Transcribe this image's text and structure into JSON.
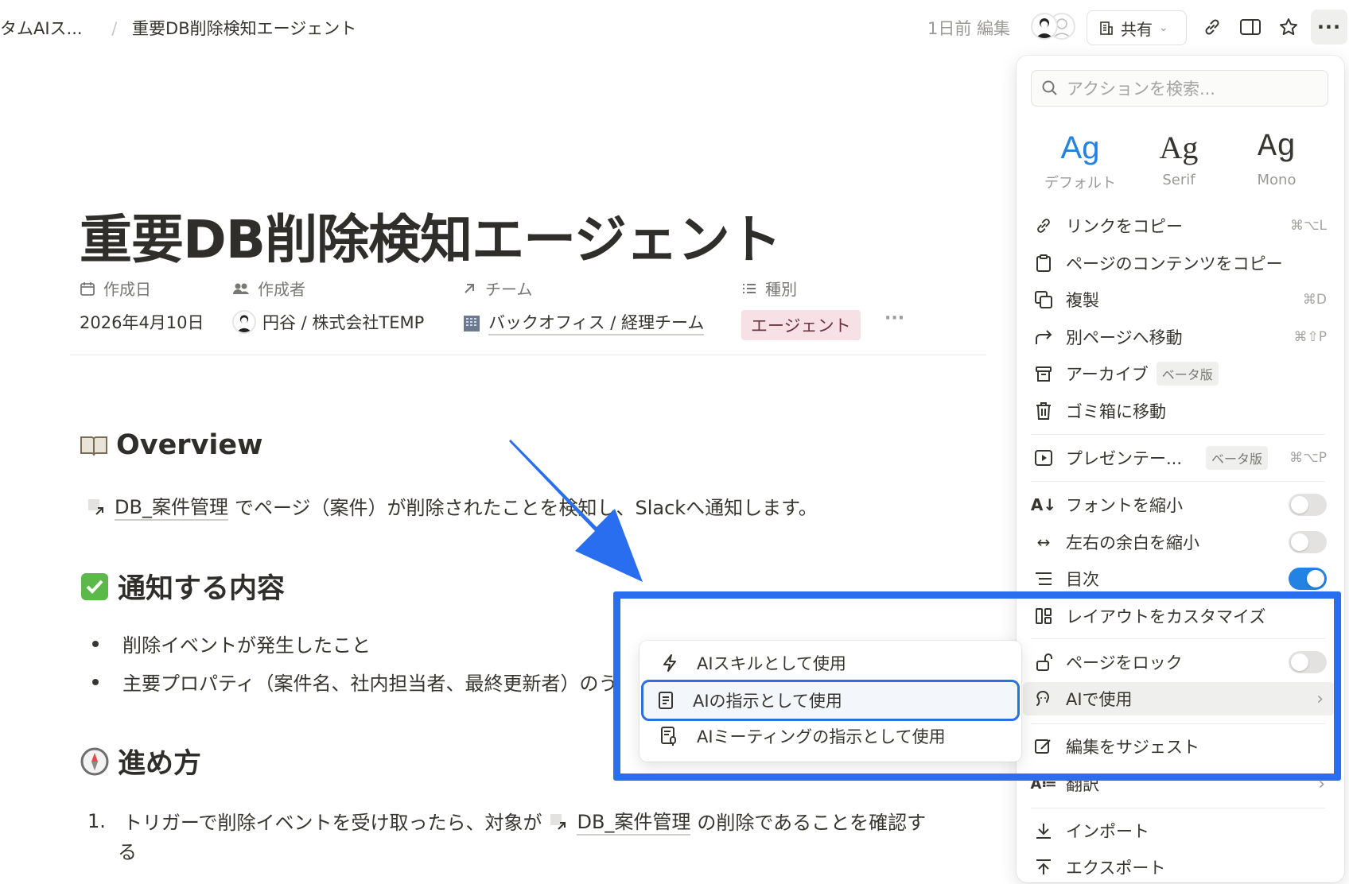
{
  "topbar": {
    "breadcrumb_parent": "タムAIス...",
    "breadcrumb_sep": "/",
    "breadcrumb_current": "重要DB削除検知エージェント",
    "edited": "1日前 編集",
    "share_label": "共有"
  },
  "page": {
    "title": "重要DB削除検知エージェント",
    "properties": [
      {
        "label": "作成日",
        "value": "2026年4月10日",
        "icon": "calendar-icon"
      },
      {
        "label": "作成者",
        "value": "円谷 / 株式会社TEMP",
        "icon": "people-icon"
      },
      {
        "label": "チーム",
        "value": "バックオフィス / 経理チーム",
        "icon": "arrow-up-right-icon"
      },
      {
        "label": "種別",
        "value": "エージェント",
        "icon": "list-icon"
      }
    ],
    "more_props": "···",
    "overview_heading": "Overview",
    "overview_link": "DB_案件管理",
    "overview_text": "でページ（案件）が削除されたことを検知し、Slackへ通知します。",
    "notify_heading": "通知する内容",
    "bullets": [
      "削除イベントが発生したこと",
      "主要プロパティ（案件名、社内担当者、最終更新者）のう"
    ],
    "process_heading": "進め方",
    "step1_num": "1.",
    "step1_pre": "トリガーで削除イベントを受け取ったら、対象が",
    "step1_link": "DB_案件管理",
    "step1_post": "の削除であることを確認す",
    "step1_cont": "る"
  },
  "menu": {
    "search_placeholder": "アクションを検索...",
    "fonts": [
      {
        "sample": "Ag",
        "name": "デフォルト"
      },
      {
        "sample": "Ag",
        "name": "Serif"
      },
      {
        "sample": "Ag",
        "name": "Mono"
      }
    ],
    "items": {
      "copy_link": {
        "label": "リンクをコピー",
        "shortcut": "⌘⌥L"
      },
      "copy_content": {
        "label": "ページのコンテンツをコピー"
      },
      "duplicate": {
        "label": "複製",
        "shortcut": "⌘D"
      },
      "move": {
        "label": "別ページへ移動",
        "shortcut": "⌘⇧P"
      },
      "archive": {
        "label": "アーカイブ",
        "badge": "ベータ版"
      },
      "trash": {
        "label": "ゴミ箱に移動"
      },
      "present": {
        "label": "プレゼンテー...",
        "badge": "ベータ版",
        "shortcut": "⌘⌥P"
      },
      "small_text": {
        "label": "フォントを縮小",
        "on": false
      },
      "full_width": {
        "label": "左右の余白を縮小",
        "on": false
      },
      "toc": {
        "label": "目次",
        "on": true
      },
      "customize_layout": {
        "label": "レイアウトをカスタマイズ"
      },
      "lock": {
        "label": "ページをロック",
        "on": false
      },
      "use_with_ai": {
        "label": "AIで使用"
      },
      "suggest_edits": {
        "label": "編集をサジェスト"
      },
      "translate": {
        "label": "翻訳"
      },
      "import": {
        "label": "インポート"
      },
      "export": {
        "label": "エクスポート"
      }
    }
  },
  "submenu": {
    "items": [
      {
        "label": "AIスキルとして使用",
        "icon": "lightning-icon"
      },
      {
        "label": "AIの指示として使用",
        "icon": "document-icon",
        "selected": true
      },
      {
        "label": "AIミーティングの指示として使用",
        "icon": "meeting-doc-icon"
      }
    ]
  },
  "colors": {
    "accent_blue": "#2a6ef0",
    "toggle_on": "#2383e2",
    "tag_bg": "#f7e1e6"
  }
}
